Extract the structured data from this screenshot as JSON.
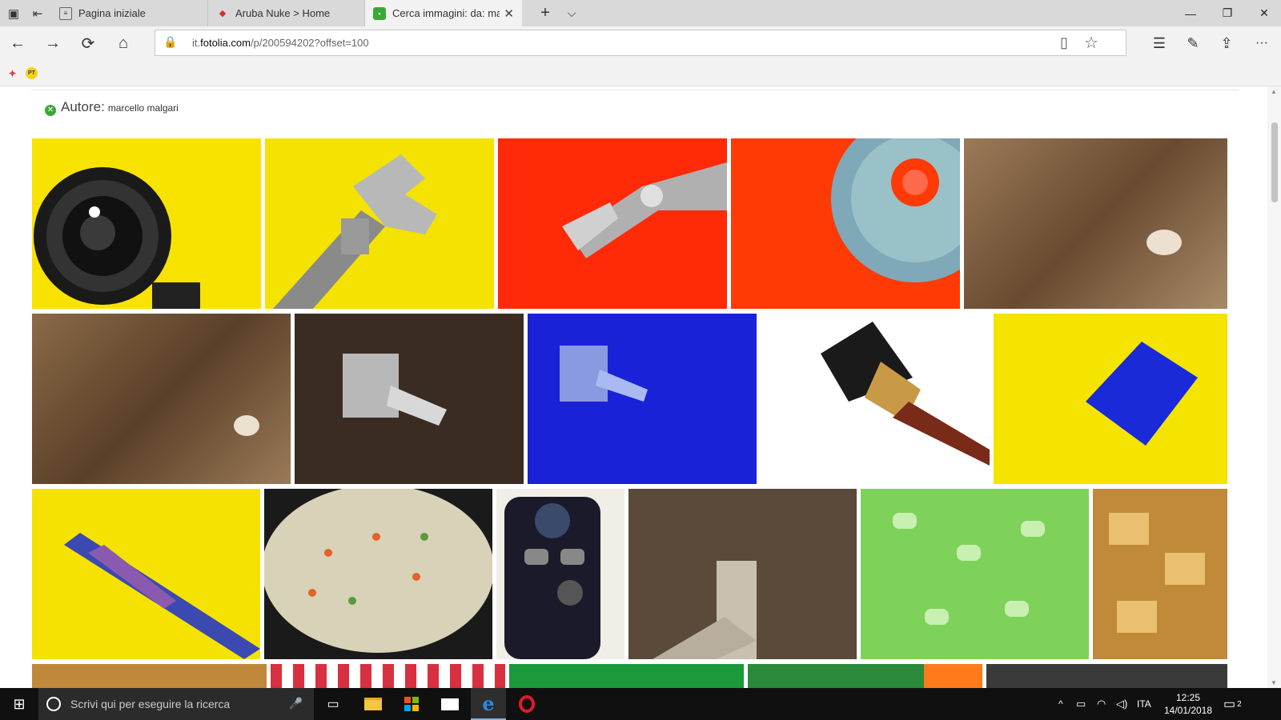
{
  "browser": {
    "tabs": [
      {
        "label": "Pagina iniziale",
        "icon": "page-icon"
      },
      {
        "label": "Aruba Nuke > Home",
        "icon": "aruba-icon"
      },
      {
        "label": "Cerca immagini: da: ma",
        "icon": "fotolia-icon",
        "active": true
      }
    ],
    "new_tab": "+",
    "tab_list": "⌵",
    "window": {
      "minimize": "—",
      "restore": "❐",
      "close": "✕"
    },
    "nav": {
      "back": "←",
      "forward": "→",
      "refresh": "⟳",
      "home": "⌂"
    },
    "address": {
      "prefix": "it.",
      "domain": "fotolia.com",
      "path": "/p/200594202?offset=100"
    },
    "toolbar": {
      "reading_view": "▯",
      "favorite": "☆",
      "hub": "☰",
      "notes": "✎",
      "share": "⇪",
      "more": "···"
    },
    "favorites": [
      {
        "label": "",
        "icon": "aruba-fav-icon",
        "color": "#e53935"
      },
      {
        "label": "PT",
        "icon": "poste-fav-icon",
        "color": "#f5d312"
      }
    ]
  },
  "page": {
    "author_label": "Autore:",
    "author_name": "marcello malgari",
    "thumbnails": [
      {
        "subject": "camera lens",
        "bg": "#f8e300"
      },
      {
        "subject": "adjustable wrench",
        "bg": "#f4e200"
      },
      {
        "subject": "pliers",
        "bg": "#ff2a08"
      },
      {
        "subject": "cd disc",
        "bg": "#ff3a05"
      },
      {
        "subject": "shell on sand under water",
        "bg": "#8a6a48"
      },
      {
        "subject": "shell on sand",
        "bg": "#7a5a3c"
      },
      {
        "subject": "halogen bulb",
        "bg": "#3a2c22"
      },
      {
        "subject": "halogen bulb blue",
        "bg": "#1a22d8"
      },
      {
        "subject": "paint brush",
        "bg": "#ffffff"
      },
      {
        "subject": "sd card",
        "bg": "#f4e400"
      },
      {
        "subject": "multicolor pen",
        "bg": "#f6e200"
      },
      {
        "subject": "vegetable risotto",
        "bg": "#d8d2b8"
      },
      {
        "subject": "camera mode dial",
        "bg": "#f0eee6"
      },
      {
        "subject": "spaghetti in hand",
        "bg": "#5a4a3a"
      },
      {
        "subject": "green packing peanuts",
        "bg": "#7ed25a"
      },
      {
        "subject": "puff pastry snacks",
        "bg": "#c08a3a"
      },
      {
        "subject": "pastries",
        "bg": "#c0883a"
      },
      {
        "subject": "checkered cloth",
        "bg": "#d83040"
      },
      {
        "subject": "circuit board",
        "bg": "#1a9a3a"
      },
      {
        "subject": "circuit board orange",
        "bg": "#2a8a3a"
      },
      {
        "subject": "machine",
        "bg": "#3a3a3a"
      }
    ]
  },
  "taskbar": {
    "start": "⊞",
    "search_placeholder": "Scrivi qui per eseguire la ricerca",
    "mic": "🎙",
    "task_view": "▭",
    "apps": [
      {
        "name": "file-explorer",
        "color": "#f4c542"
      },
      {
        "name": "store",
        "color": "#ffffff"
      },
      {
        "name": "mail",
        "color": "#ffffff"
      },
      {
        "name": "edge",
        "color": "#2a8ae0"
      },
      {
        "name": "opera",
        "color": "#e01a2a"
      }
    ],
    "tray_chevron": "^",
    "language": "ITA",
    "time": "12:25",
    "date": "14/01/2018",
    "notifications": "2"
  }
}
